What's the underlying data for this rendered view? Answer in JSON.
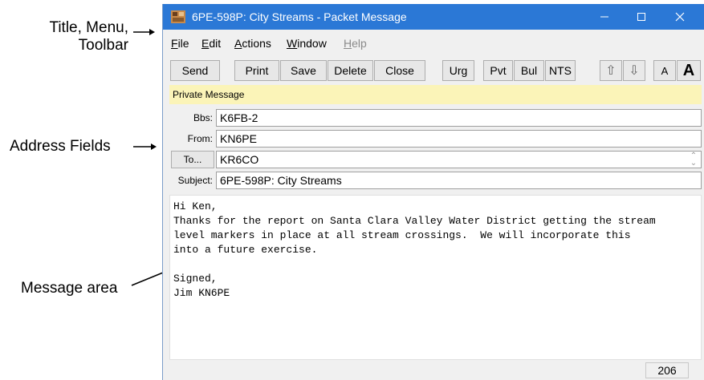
{
  "annotations": {
    "title_line1": "Title, Menu,",
    "title_line2": "Toolbar",
    "address": "Address Fields",
    "message": "Message area"
  },
  "window": {
    "title": "6PE-598P: City Streams - Packet Message",
    "accent_color": "#2b78d6"
  },
  "menu": {
    "file": {
      "u": "F",
      "rest": "ile"
    },
    "edit": {
      "u": "E",
      "rest": "dit"
    },
    "actions": {
      "u": "A",
      "rest": "ctions"
    },
    "window": {
      "u": "W",
      "rest": "indow"
    },
    "help": {
      "u": "H",
      "rest": "elp"
    }
  },
  "toolbar": {
    "send": "Send",
    "print": "Print",
    "save": "Save",
    "delete": "Delete",
    "close": "Close",
    "urg": "Urg",
    "pvt": "Pvt",
    "bul": "Bul",
    "nts": "NTS",
    "up": "⇧",
    "down": "⇩",
    "font_small": "A",
    "font_large": "A"
  },
  "private_label": "Private Message",
  "fields": {
    "bbs_label": "Bbs:",
    "bbs_value": "K6FB-2",
    "from_label": "From:",
    "from_value": "KN6PE",
    "to_button": "To...",
    "to_value": "KR6CO",
    "subject_label": "Subject:",
    "subject_value": "6PE-598P: City Streams"
  },
  "message_body": "Hi Ken,\nThanks for the report on Santa Clara Valley Water District getting the stream\nlevel markers in place at all stream crossings.  We will incorporate this\ninto a future exercise.\n\nSigned,\nJim KN6PE",
  "status": {
    "count": "206"
  }
}
